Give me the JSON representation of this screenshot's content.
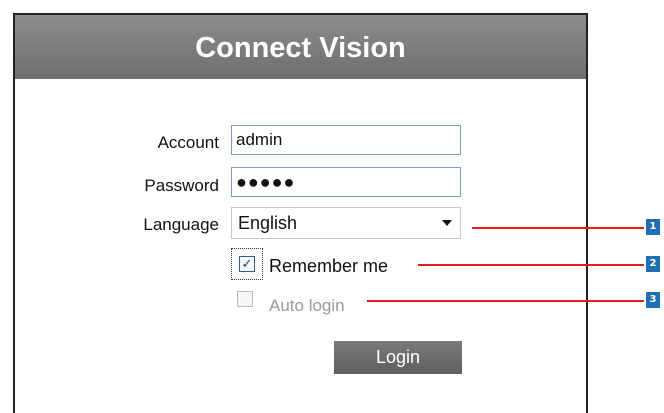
{
  "app": {
    "title": "Connect Vision"
  },
  "form": {
    "account_label": "Account",
    "account_value": "admin",
    "password_label": "Password",
    "password_value": "●●●●●",
    "language_label": "Language",
    "language_value": "English",
    "remember_label": "Remember me",
    "remember_checked": true,
    "autologin_label": "Auto login",
    "autologin_checked": false,
    "autologin_enabled": false,
    "login_label": "Login"
  },
  "callouts": {
    "items": [
      "1",
      "2",
      "3"
    ],
    "line_color": "#e31b1b",
    "badge_color": "#1f6fb5"
  }
}
